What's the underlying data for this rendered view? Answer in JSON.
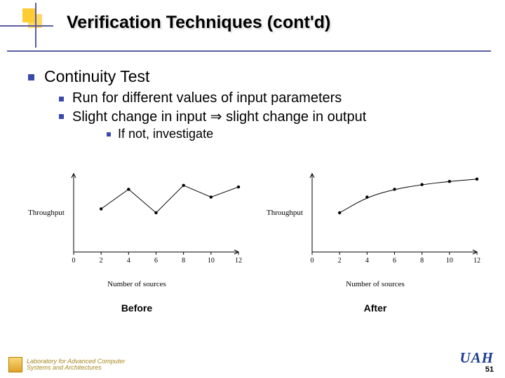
{
  "title": "Verification Techniques (cont'd)",
  "bullets": {
    "l1": "Continuity Test",
    "l2a": "Run for different values of input parameters",
    "l2b": "Slight change in input ⇒ slight change in output",
    "l3": "If not, investigate"
  },
  "captions": {
    "before": "Before",
    "after": "After"
  },
  "chart_data": [
    {
      "type": "line",
      "title": "",
      "xlabel": "Number of sources",
      "ylabel": "Throughput",
      "xlim": [
        0,
        12
      ],
      "ylim": [
        0,
        10
      ],
      "x_ticks": [
        0,
        2,
        4,
        6,
        8,
        10,
        12
      ],
      "series": [
        {
          "name": "before",
          "x": [
            2,
            4,
            6,
            8,
            10,
            12
          ],
          "y": [
            5.5,
            8.0,
            5.0,
            8.5,
            7.0,
            8.3
          ]
        }
      ]
    },
    {
      "type": "line",
      "title": "",
      "xlabel": "Number of sources",
      "ylabel": "Throughput",
      "xlim": [
        0,
        12
      ],
      "ylim": [
        0,
        10
      ],
      "x_ticks": [
        0,
        2,
        4,
        6,
        8,
        10,
        12
      ],
      "series": [
        {
          "name": "after",
          "x": [
            2,
            4,
            6,
            8,
            10,
            12
          ],
          "y": [
            5.0,
            7.0,
            8.0,
            8.6,
            9.0,
            9.3
          ]
        }
      ]
    }
  ],
  "footer": {
    "lab_line1": "Laboratory for Advanced Computer",
    "lab_line2": "Systems and Architectures",
    "org": "UAH",
    "page": "51"
  }
}
